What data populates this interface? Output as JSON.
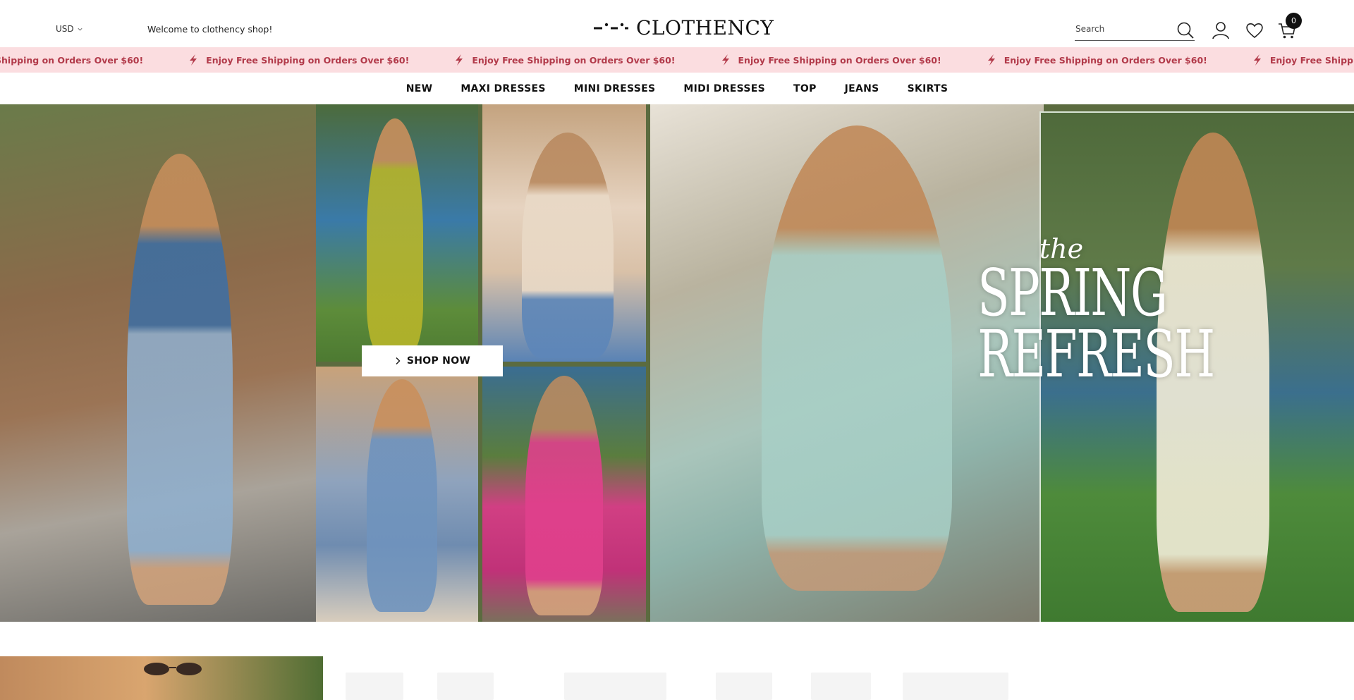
{
  "header": {
    "currency": "USD",
    "welcome": "Welcome to clothency shop!",
    "brand": "CLOTHENCY",
    "search_placeholder": "Search",
    "cart_count": "0"
  },
  "announcement": {
    "items": [
      "Enjoy Free Shipping on Orders Over $60!",
      "Enjoy Free Shipping on Orders Over $60!",
      "Enjoy Free Shipping on Orders Over $60!",
      "Enjoy Free Shipping on Orders Over $60!",
      "Enjoy Free Shipping on Orders Over $60!",
      "Enjoy Free Shipping on Orders Over $60!"
    ]
  },
  "nav": {
    "items": [
      "NEW",
      "MAXI DRESSES",
      "MINI DRESSES",
      "MIDI DRESSES",
      "TOP",
      "JEANS",
      "SKIRTS"
    ]
  },
  "hero": {
    "title_the": "the",
    "title_line1": "SPRING",
    "title_line2": "REFRESH",
    "cta": "SHOP NOW"
  },
  "colors": {
    "announcement_bg": "#fbdde0",
    "announcement_text": "#b23a4a",
    "text_primary": "#111111"
  },
  "icons": [
    "chevron-down-icon",
    "search-icon",
    "user-icon",
    "heart-icon",
    "cart-icon",
    "bolt-icon",
    "chevron-right-icon"
  ]
}
